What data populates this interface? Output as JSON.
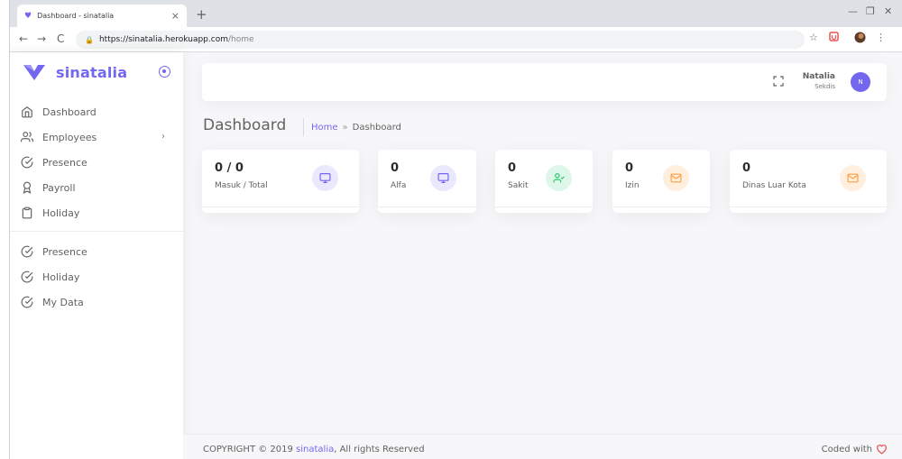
{
  "browser": {
    "tab_title": "Dashboard - sinatalia",
    "tab_close": "×",
    "new_tab": "+",
    "url_host": "https://sinatalia.herokuapp.com",
    "url_path": "/home",
    "back": "←",
    "forward": "→",
    "reload": "C",
    "bookmark": "☆",
    "menu": "⋮",
    "minimize": "—",
    "maximize": "❐",
    "close": "✕"
  },
  "sidebar": {
    "brand": "sinatalia",
    "items": [
      {
        "label": "Dashboard",
        "icon": "home-icon"
      },
      {
        "label": "Employees",
        "icon": "users-icon",
        "has_submenu": true
      },
      {
        "label": "Presence",
        "icon": "check-circle-icon"
      },
      {
        "label": "Payroll",
        "icon": "bookmark-icon"
      },
      {
        "label": "Holiday",
        "icon": "clipboard-icon"
      }
    ],
    "items2": [
      {
        "label": "Presence",
        "icon": "check-circle-icon"
      },
      {
        "label": "Holiday",
        "icon": "check-circle-icon"
      },
      {
        "label": "My Data",
        "icon": "check-circle-icon"
      }
    ]
  },
  "header": {
    "user_name": "Natalia",
    "user_role": "Sekdis",
    "avatar_initial": "N"
  },
  "page": {
    "title": "Dashboard",
    "breadcrumb_home": "Home",
    "breadcrumb_sep": "»",
    "breadcrumb_current": "Dashboard"
  },
  "cards": [
    {
      "value": "0 / 0",
      "label": "Masuk / Total",
      "icon": "monitor-icon",
      "color": "#7367f0"
    },
    {
      "value": "0",
      "label": "Alfa",
      "icon": "monitor-icon",
      "color": "#7367f0"
    },
    {
      "value": "0",
      "label": "Sakit",
      "icon": "user-check-icon",
      "color": "#28c76f"
    },
    {
      "value": "0",
      "label": "Izin",
      "icon": "mail-icon",
      "color": "#ff9f43"
    },
    {
      "value": "0",
      "label": "Dinas Luar Kota",
      "icon": "mail-icon",
      "color": "#ff9f43"
    }
  ],
  "footer": {
    "copyright_prefix": "COPYRIGHT © 2019",
    "copyright_brand": "sinatalia",
    "copyright_suffix": ", All rights Reserved",
    "coded_with": "Coded with"
  },
  "colors": {
    "primary": "#7367f0",
    "success": "#28c76f",
    "warning": "#ff9f43",
    "danger": "#ea5455"
  }
}
